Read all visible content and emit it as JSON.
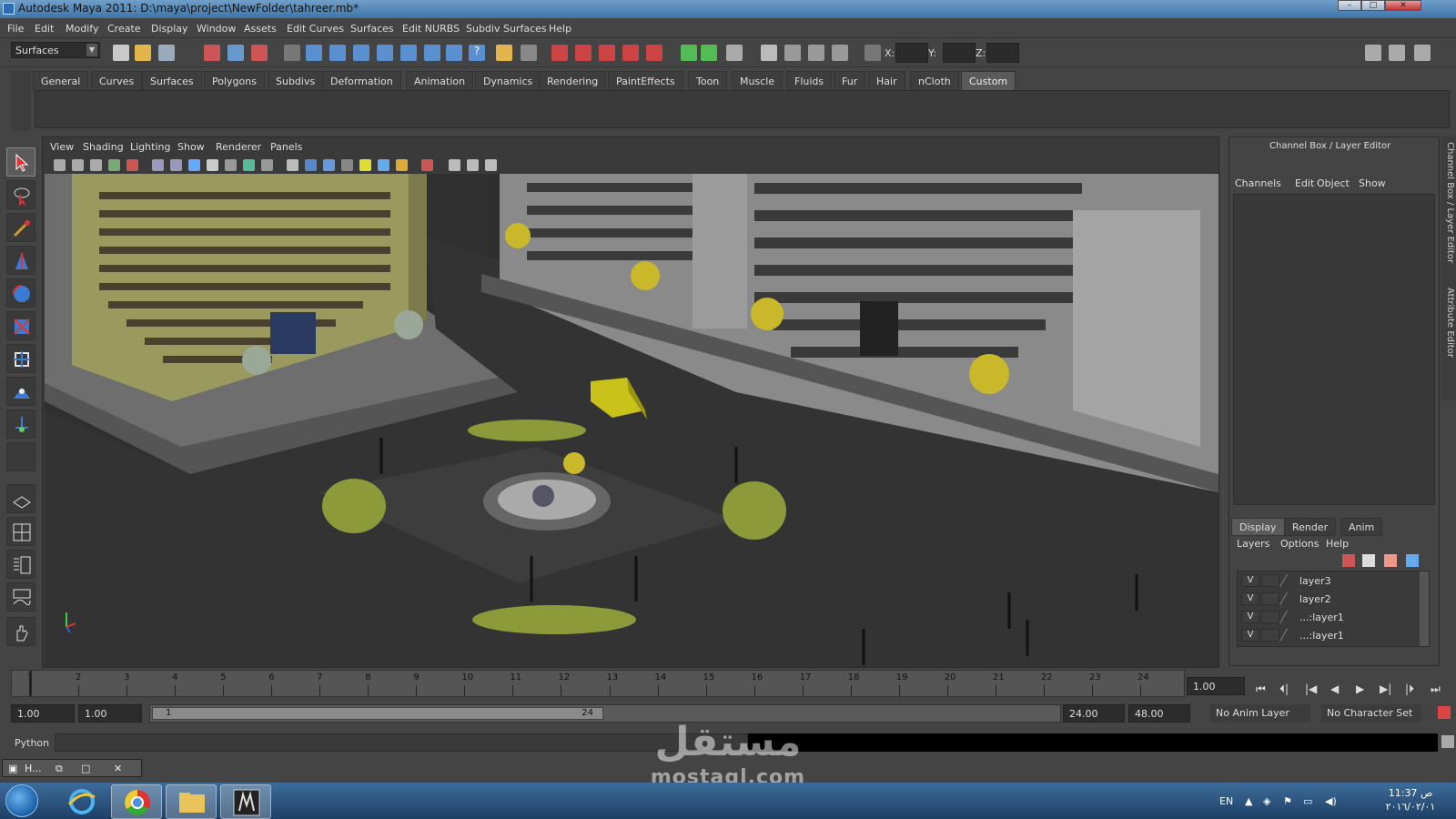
{
  "window": {
    "title": "Autodesk Maya 2011: D:\\maya\\project\\NewFolder\\tahreer.mb*"
  },
  "menubar": [
    "File",
    "Edit",
    "Modify",
    "Create",
    "Display",
    "Window",
    "Assets",
    "Edit Curves",
    "Surfaces",
    "Edit NURBS",
    "Subdiv Surfaces",
    "Help"
  ],
  "statusline": {
    "mode": "Surfaces",
    "x_label": "X:",
    "y_label": "Y:",
    "z_label": "Z:"
  },
  "shelf": {
    "tabs": [
      "General",
      "Curves",
      "Surfaces",
      "Polygons",
      "Subdivs",
      "Deformation",
      "Animation",
      "Dynamics",
      "Rendering",
      "PaintEffects",
      "Toon",
      "Muscle",
      "Fluids",
      "Fur",
      "Hair",
      "nCloth",
      "Custom"
    ],
    "active": "Custom"
  },
  "viewport": {
    "menus": [
      "View",
      "Shading",
      "Lighting",
      "Show",
      "Renderer",
      "Panels"
    ]
  },
  "channelbox": {
    "title": "Channel Box / Layer Editor",
    "menus": [
      "Channels",
      "Edit",
      "Object",
      "Show"
    ],
    "layer_tabs": [
      "Display",
      "Render",
      "Anim"
    ],
    "layer_menus": [
      "Layers",
      "Options",
      "Help"
    ],
    "layers": [
      {
        "visible": "V",
        "name": "layer3"
      },
      {
        "visible": "V",
        "name": "layer2"
      },
      {
        "visible": "V",
        "name": "...:layer1"
      },
      {
        "visible": "V",
        "name": "...:layer1"
      }
    ],
    "side_tabs": [
      "Channel Box / Layer Editor",
      "Attribute Editor"
    ]
  },
  "timeline": {
    "ticks": [
      "1",
      "2",
      "3",
      "4",
      "5",
      "6",
      "7",
      "8",
      "9",
      "10",
      "11",
      "12",
      "13",
      "14",
      "15",
      "16",
      "17",
      "18",
      "19",
      "20",
      "21",
      "22",
      "23",
      "24"
    ],
    "current_frame": "1.00"
  },
  "range": {
    "start": "1.00",
    "playback_start": "1.00",
    "handle_start": "1",
    "handle_end": "24",
    "playback_end": "24.00",
    "end": "48.00",
    "anim_layer": "No Anim Layer",
    "character_set": "No Character Set"
  },
  "cmdline": {
    "label": "Python"
  },
  "minimized_window": {
    "label": "H..."
  },
  "taskbar": {
    "language": "EN",
    "time": "11:37 ص",
    "date": "٢٠١٦/٠٢/٠١"
  },
  "watermark": {
    "arabic": "مستقل",
    "latin": "mostaql.com"
  }
}
